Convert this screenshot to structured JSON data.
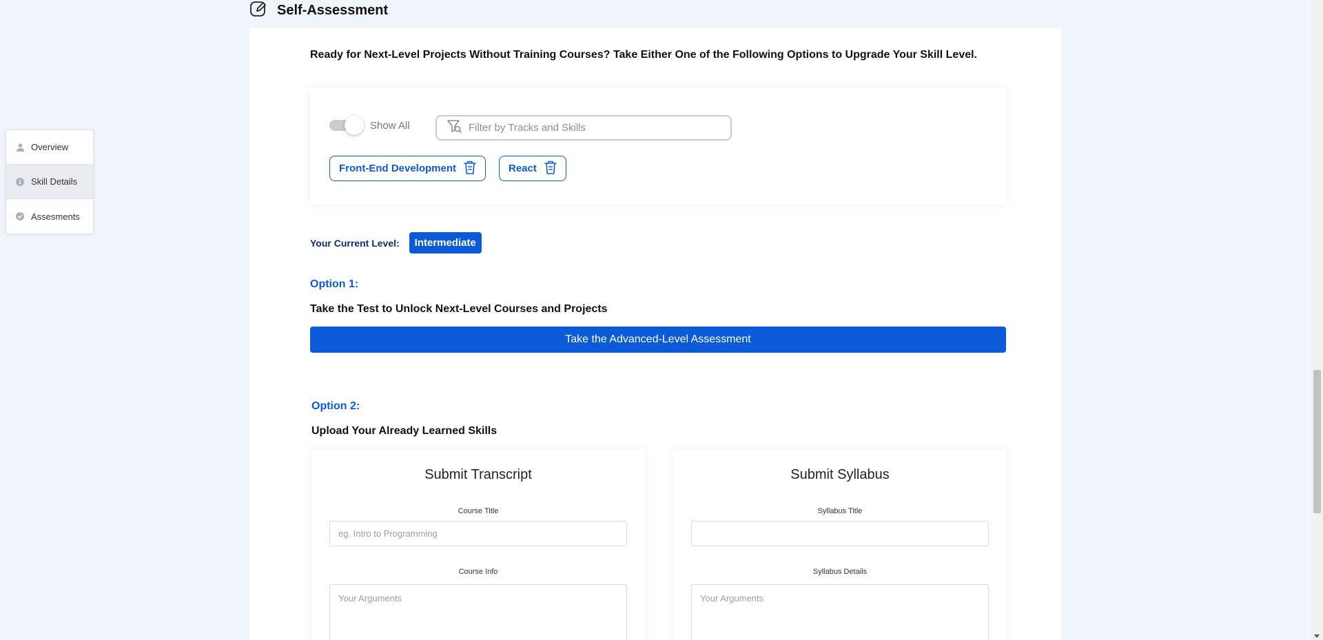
{
  "header": {
    "title": "Self-Assessment",
    "icon": "edit-icon"
  },
  "sidebar": {
    "items": [
      {
        "label": "Overview",
        "icon": "person-icon"
      },
      {
        "label": "Skill Details",
        "icon": "info-icon"
      },
      {
        "label": "Assesments",
        "icon": "check-circle-icon"
      }
    ]
  },
  "main": {
    "intro": "Ready for Next-Level Projects Without Training Courses? Take Either One of the Following Options to Upgrade Your Skill Level.",
    "filter": {
      "toggle_label": "Show All",
      "placeholder": "Filter by Tracks and Skills",
      "chips": [
        {
          "label": "Front-End Development"
        },
        {
          "label": "React"
        }
      ]
    },
    "level": {
      "label": "Your Current Level:",
      "value": "Intermediate"
    },
    "option1": {
      "label": "Option 1:",
      "text": "Take the Test to Unlock Next-Level Courses and Projects",
      "button": "Take the Advanced-Level Assessment"
    },
    "option2": {
      "label": "Option 2:",
      "text": "Upload Your Already Learned Skills",
      "transcript": {
        "title": "Submit Transcript",
        "field1_label": "Course Title",
        "field1_placeholder": "eg. Intro to Programming",
        "field2_label": "Course Info",
        "field2_placeholder": "Your Arguments"
      },
      "syllabus": {
        "title": "Submit Syllabus",
        "field1_label": "Syllabus Title",
        "field1_placeholder": "",
        "field2_label": "Syllabus Details",
        "field2_placeholder": "Your Arguments"
      }
    }
  },
  "colors": {
    "accent": "#0b5bd9",
    "dark_blue": "#0d2f6e",
    "background": "#f0f4fb"
  }
}
